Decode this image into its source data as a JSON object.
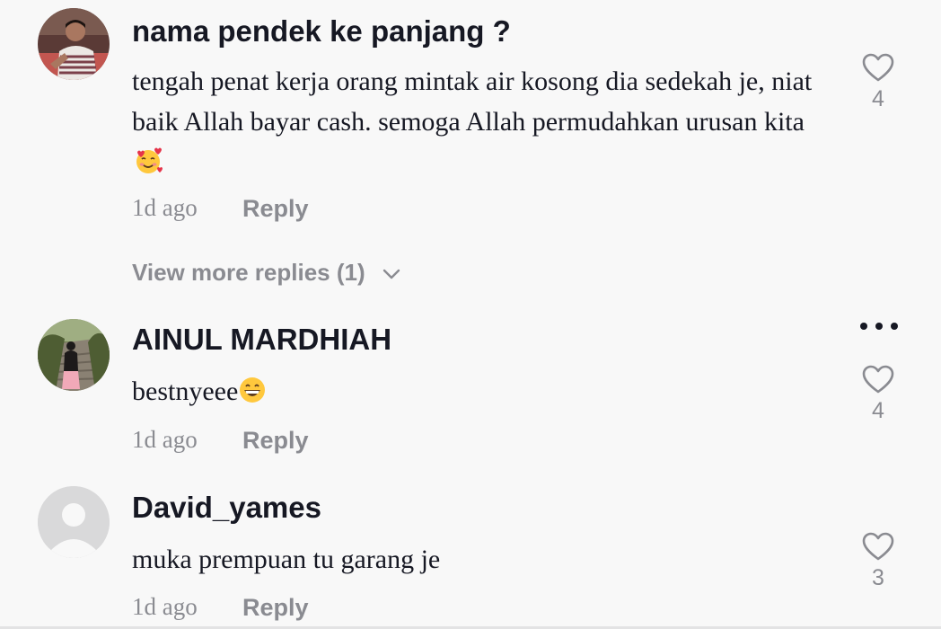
{
  "comments": [
    {
      "username": "nama pendek ke panjang ?",
      "text": "tengah penat kerja orang mintak air kosong dia sedekah je, niat baik Allah bayar cash. semoga Allah permudahkan urusan kita",
      "emoji": "smiling-face-with-hearts",
      "time": "1d ago",
      "reply_label": "Reply",
      "likes": "4"
    },
    {
      "username": "AINUL MARDHIAH",
      "text": "bestnyeee",
      "emoji": "grinning-face",
      "time": "1d ago",
      "reply_label": "Reply",
      "likes": "4"
    },
    {
      "username": "David_yames",
      "text": "muka prempuan tu garang je",
      "time": "1d ago",
      "reply_label": "Reply",
      "likes": "3"
    }
  ],
  "view_more_replies": "View more replies (1)",
  "icons": {
    "like": "heart-outline-icon",
    "more": "more-dots-icon",
    "expand": "chevron-down-icon"
  },
  "colors": {
    "background": "#f8f8f8",
    "text": "#161823",
    "secondary": "#8a8b91"
  }
}
